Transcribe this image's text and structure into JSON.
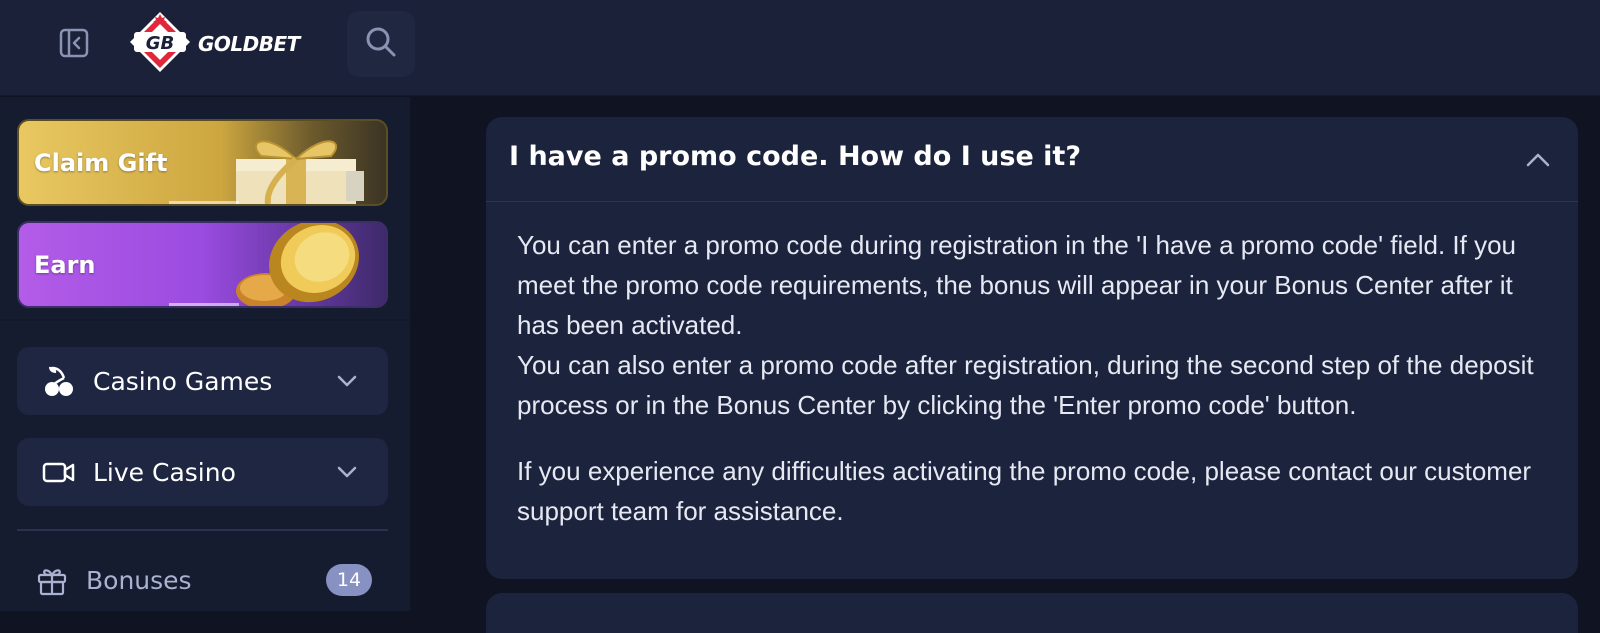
{
  "header": {
    "brand_name": "GOLDBET",
    "logo_monogram": "GB"
  },
  "sidebar": {
    "promos": [
      {
        "label": "Claim Gift"
      },
      {
        "label": "Earn"
      }
    ],
    "nav": [
      {
        "label": "Casino Games"
      },
      {
        "label": "Live Casino"
      }
    ],
    "bonuses": {
      "label": "Bonuses",
      "count": "14"
    }
  },
  "faq": {
    "question": "I have a promo code. How do I use it?",
    "answer": [
      "You can enter a promo code during registration in the 'I have a promo code' field. If you meet the promo code requirements, the bonus will appear in your Bonus Center after it has been activated.",
      "You can also enter a promo code after registration, during the second step of the deposit process or in the Bonus Center by clicking the 'Enter promo code' button.",
      "If you experience any difficulties activating the promo code, please contact our customer support team for assistance."
    ]
  },
  "colors": {
    "topbar_bg": "#1a2138",
    "page_bg": "#0f1322",
    "card_bg": "#1c233d",
    "gift_gold": "#e9c861",
    "earn_purple": "#b35ce8",
    "badge_bg": "#8791c2"
  },
  "icons": {
    "collapse": "sidebar-collapse-icon",
    "search": "search-icon",
    "casino": "cherries-icon",
    "live": "video-camera-icon",
    "chevron": "chevron-down-icon",
    "faq_toggle": "chevron-up-icon",
    "bonuses": "gift-icon"
  }
}
